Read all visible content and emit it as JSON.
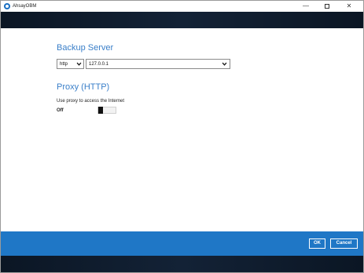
{
  "window": {
    "title": "AhsayOBM",
    "minimize_glyph": "—",
    "close_glyph": "✕"
  },
  "backup_server": {
    "heading": "Backup Server",
    "protocol": "http",
    "host": "127.0.0.1"
  },
  "proxy": {
    "heading": "Proxy (HTTP)",
    "use_proxy_label": "Use proxy to access the Internet",
    "state_label": "Off",
    "enabled": false
  },
  "footer": {
    "ok_label": "OK",
    "cancel_label": "Cancel"
  },
  "colors": {
    "accent": "#3a7fc9",
    "footer_blue": "#1f77c6",
    "dark_band": "#0d1a2a"
  },
  "icons": [
    "app-logo-icon",
    "chevron-down-icon"
  ]
}
